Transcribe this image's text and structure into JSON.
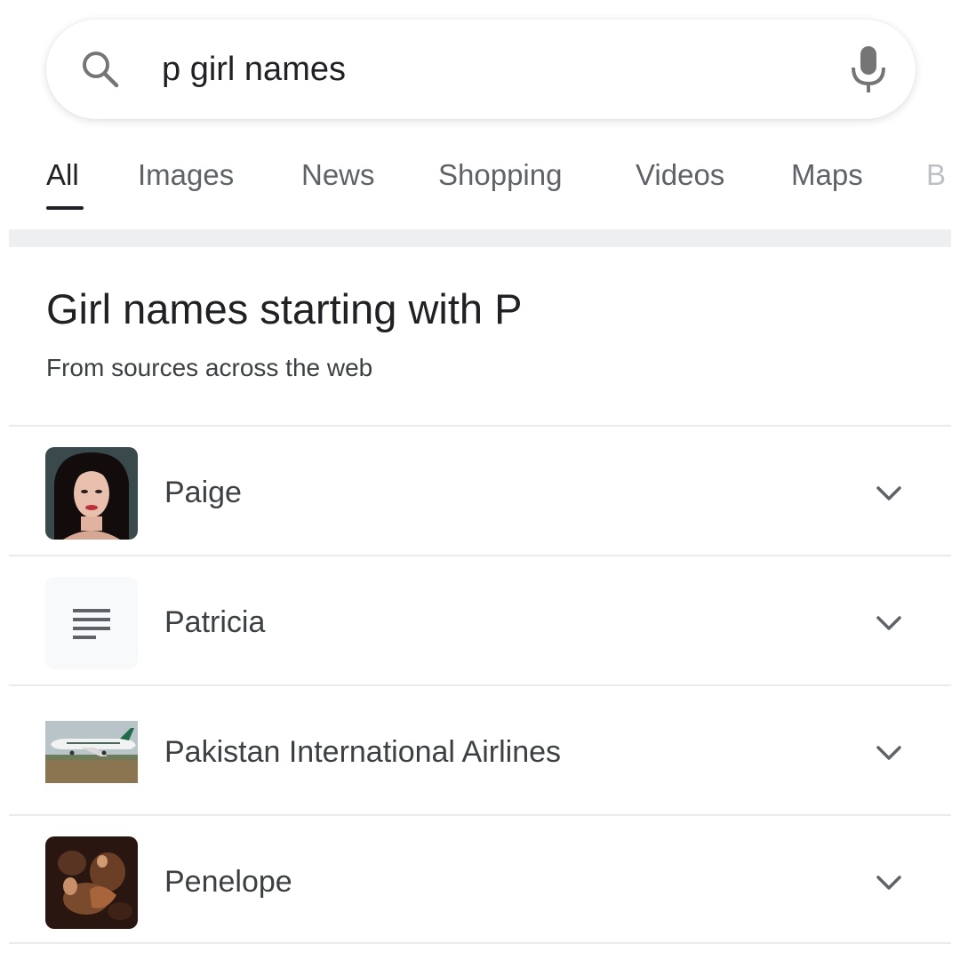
{
  "search": {
    "query": "p girl names",
    "search_icon": "search-icon",
    "mic_icon": "microphone-icon"
  },
  "tabs": [
    {
      "label": "All",
      "active": true
    },
    {
      "label": "Images",
      "active": false
    },
    {
      "label": "News",
      "active": false
    },
    {
      "label": "Shopping",
      "active": false
    },
    {
      "label": "Videos",
      "active": false
    },
    {
      "label": "Maps",
      "active": false
    },
    {
      "label": "B",
      "active": false
    }
  ],
  "panel": {
    "title": "Girl names starting with P",
    "subtitle": "From sources across the web"
  },
  "results": [
    {
      "label": "Paige",
      "thumbnail": "portrait-photo"
    },
    {
      "label": "Patricia",
      "thumbnail": "article-lines-icon"
    },
    {
      "label": "Pakistan International Airlines",
      "thumbnail": "airplane-photo"
    },
    {
      "label": "Penelope",
      "thumbnail": "painting-photo"
    }
  ],
  "colors": {
    "text_primary": "#202124",
    "text_secondary": "#5f6368",
    "divider": "#ebebeb"
  }
}
